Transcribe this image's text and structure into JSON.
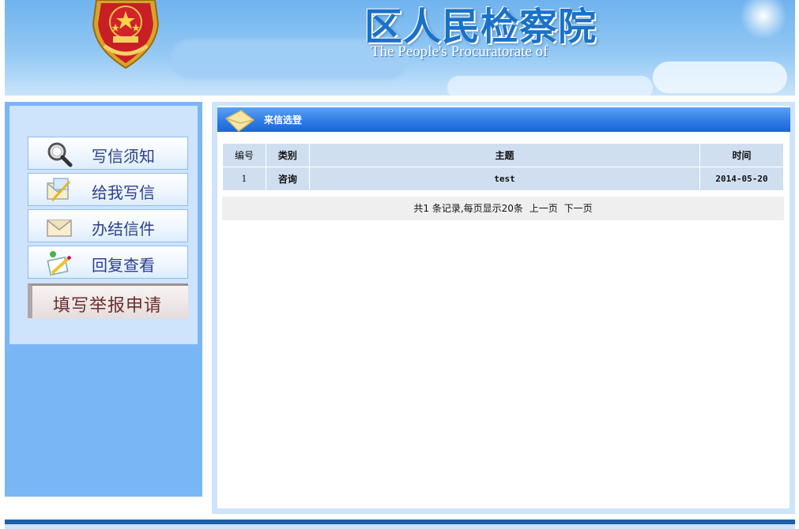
{
  "header": {
    "title": "区人民检察院",
    "subtitle": "The People's Procuratorate of"
  },
  "sidebar": {
    "items": [
      {
        "label": "写信须知",
        "icon": "magnifier-icon"
      },
      {
        "label": "给我写信",
        "icon": "envelope-pen-icon"
      },
      {
        "label": "办结信件",
        "icon": "envelope-icon"
      },
      {
        "label": "回复查看",
        "icon": "edit-pencil-icon"
      }
    ],
    "report_button": "填写举报申请"
  },
  "main": {
    "section_title": "来信选登",
    "section_icon": "envelope-icon",
    "table": {
      "headers": [
        "编号",
        "类别",
        "主题",
        "时间"
      ],
      "rows": [
        {
          "id": "1",
          "category": "咨询",
          "subject": "test",
          "date": "2014-05-20"
        }
      ]
    },
    "pager": {
      "summary": "共1 条记录,每页显示20条",
      "prev": "上一页",
      "next": "下一页"
    }
  },
  "colors": {
    "banner_blue": "#6fb3ee",
    "header_bar": "#2f7ce6",
    "sidebar_blue": "#79b6f6",
    "panel_light": "#cee3fc",
    "table_cell": "#d0dff0"
  }
}
